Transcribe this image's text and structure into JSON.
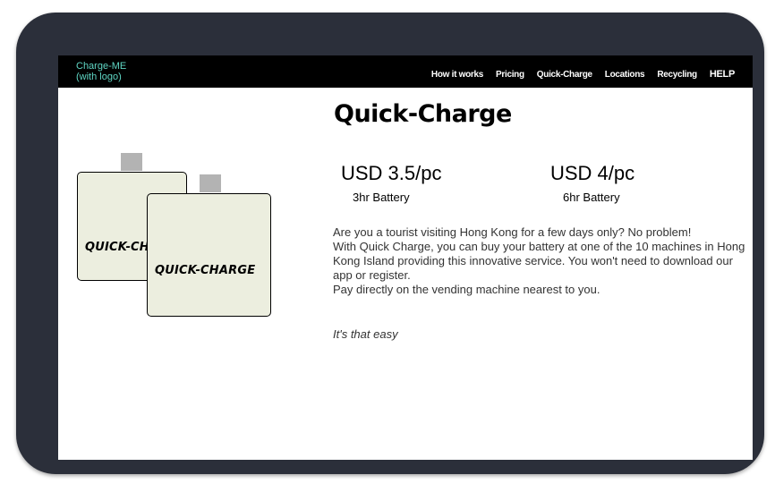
{
  "navbar": {
    "logo_line1": "Charge-ME",
    "logo_line2": "(with logo)",
    "links": [
      {
        "label": "How it works"
      },
      {
        "label": "Pricing"
      },
      {
        "label": "Quick-Charge"
      },
      {
        "label": "Locations"
      },
      {
        "label": "Recycling"
      },
      {
        "label": "HELP"
      }
    ]
  },
  "page": {
    "title": "Quick-Charge",
    "prices": [
      {
        "price": "USD 3.5/pc",
        "battery": "3hr Battery"
      },
      {
        "price": "USD 4/pc",
        "battery": "6hr Battery"
      }
    ],
    "description": [
      "Are you a tourist visiting Hong Kong for a few days only? No problem!",
      "With Quick Charge, you can buy your battery at one of the 10 machines in Hong Kong Island providing this innovative service. You won't need to download our app or register.",
      "Pay directly on the vending machine nearest to you."
    ],
    "tagline": "It's that easy"
  },
  "illustration": {
    "brand_text_1": "QUICK-CHARGE",
    "brand_text_2": "QUICK-CHARGE"
  },
  "colors": {
    "device_frame": "#2b2f3a",
    "navbar_bg": "#000000",
    "logo_color": "#5fd6c4",
    "battery_fill": "#eceedf",
    "battery_cap": "#b3b3b3"
  }
}
